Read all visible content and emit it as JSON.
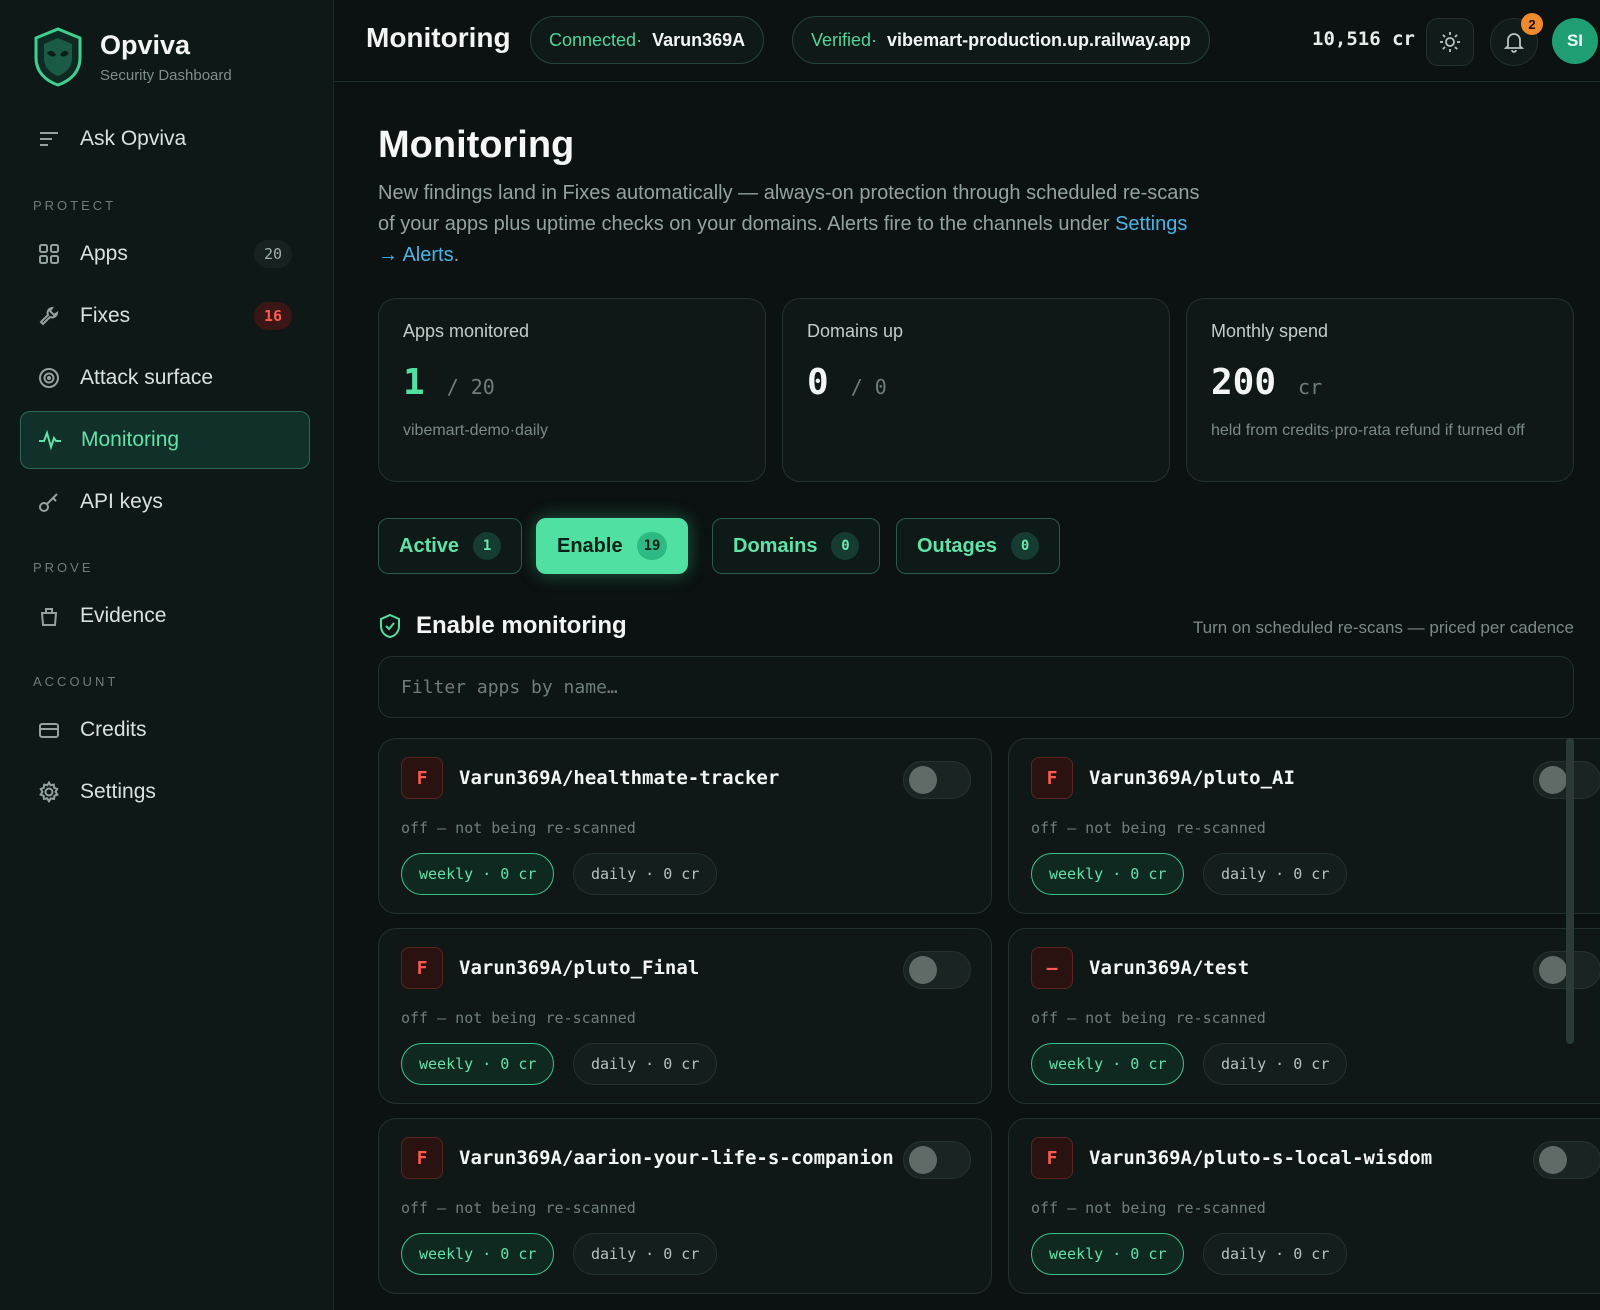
{
  "brand": {
    "name": "Opviva",
    "subtitle": "Security Dashboard"
  },
  "sidebar": {
    "ask": "Ask Opviva",
    "sections": {
      "protect": "PROTECT",
      "prove": "PROVE",
      "account": "ACCOUNT"
    },
    "items": {
      "apps": {
        "label": "Apps",
        "count": "20"
      },
      "fixes": {
        "label": "Fixes",
        "count": "16"
      },
      "attack_surface": {
        "label": "Attack surface"
      },
      "monitoring": {
        "label": "Monitoring"
      },
      "api_keys": {
        "label": "API keys"
      },
      "evidence": {
        "label": "Evidence"
      },
      "credits": {
        "label": "Credits"
      },
      "settings": {
        "label": "Settings"
      }
    }
  },
  "topbar": {
    "title": "Monitoring",
    "connected": {
      "key": "Connected·",
      "value": "Varun369A"
    },
    "verified": {
      "key": "Verified·",
      "value": "vibemart-production.up.railway.app"
    },
    "credits": "10,516 cr",
    "notifications": "2",
    "avatar": "SI"
  },
  "page": {
    "title": "Monitoring",
    "description": "New findings land in Fixes automatically — always-on protection through scheduled re-scans of your apps plus uptime checks on your domains. Alerts fire to the channels under",
    "link": "Settings → Alerts",
    "link_suffix": "."
  },
  "stats": {
    "apps": {
      "label": "Apps monitored",
      "value": "1",
      "of": "/ 20",
      "sub": "vibemart-demo·daily"
    },
    "domains": {
      "label": "Domains up",
      "value": "0",
      "of": "/ 0"
    },
    "spend": {
      "label": "Monthly spend",
      "value": "200",
      "unit": "cr",
      "sub": "held from credits·pro-rata refund if turned off"
    }
  },
  "tabs": {
    "active": {
      "label": "Active",
      "count": "1"
    },
    "enable": {
      "label": "Enable",
      "count": "19"
    },
    "domains": {
      "label": "Domains",
      "count": "0"
    },
    "outages": {
      "label": "Outages",
      "count": "0"
    }
  },
  "section": {
    "title": "Enable monitoring",
    "note": "Turn on scheduled re-scans — priced per cadence",
    "filter_placeholder": "Filter apps by name…"
  },
  "colors": {
    "accent": "#4fe0a2",
    "danger": "#ff5a4f",
    "background": "#0b1211"
  },
  "apps": [
    {
      "grade": "F",
      "name": "Varun369A/healthmate-tracker",
      "status": "off — not being re-scanned",
      "weekly": "weekly · 0 cr",
      "daily": "daily · 0 cr",
      "enabled": false
    },
    {
      "grade": "F",
      "name": "Varun369A/pluto_AI",
      "status": "off — not being re-scanned",
      "weekly": "weekly · 0 cr",
      "daily": "daily · 0 cr",
      "enabled": false
    },
    {
      "grade": "F",
      "name": "Varun369A/pluto_Final",
      "status": "off — not being re-scanned",
      "weekly": "weekly · 0 cr",
      "daily": "daily · 0 cr",
      "enabled": false
    },
    {
      "grade": "—",
      "name": "Varun369A/test",
      "status": "off — not being re-scanned",
      "weekly": "weekly · 0 cr",
      "daily": "daily · 0 cr",
      "enabled": false
    },
    {
      "grade": "F",
      "name": "Varun369A/aarion-your-life-s-companion",
      "status": "off — not being re-scanned",
      "weekly": "weekly · 0 cr",
      "daily": "daily · 0 cr",
      "enabled": false
    },
    {
      "grade": "F",
      "name": "Varun369A/pluto-s-local-wisdom",
      "status": "off — not being re-scanned",
      "weekly": "weekly · 0 cr",
      "daily": "daily · 0 cr",
      "enabled": false
    }
  ]
}
